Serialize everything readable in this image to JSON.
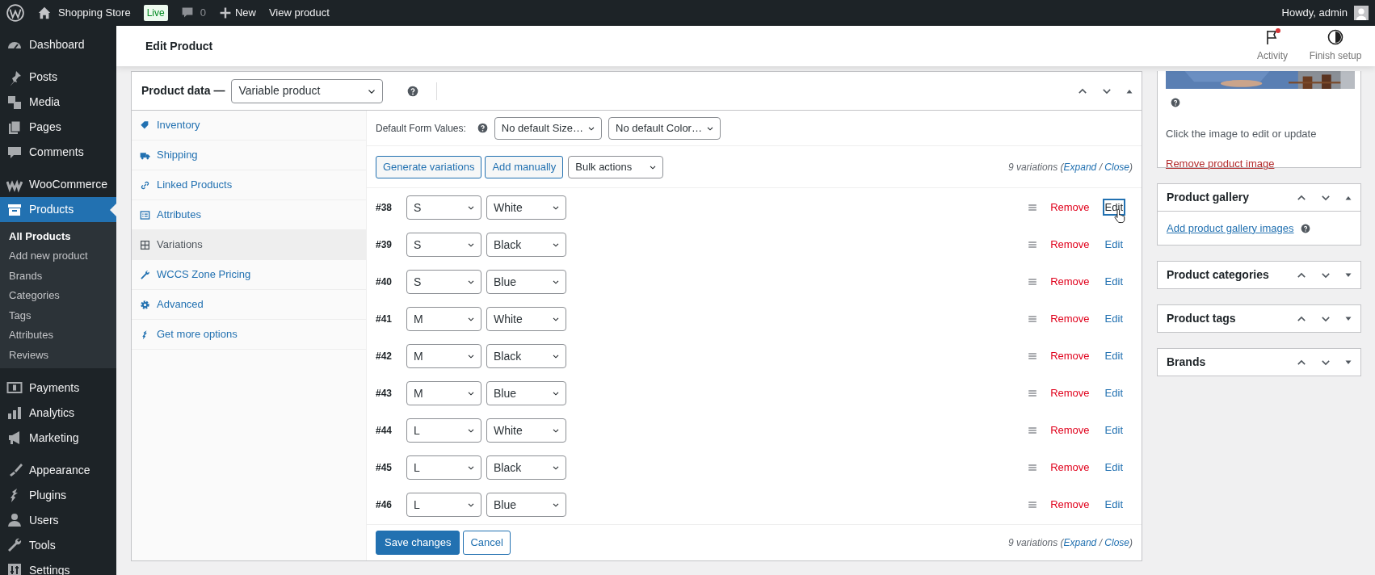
{
  "admin_bar": {
    "site_name": "Shopping Store",
    "badge": "Live",
    "comments": "0",
    "new": "New",
    "view": "View product",
    "greeting": "Howdy, admin"
  },
  "sidebar": {
    "groups": [
      [
        {
          "label": "Dashboard",
          "selected": false
        }
      ],
      [
        {
          "label": "Posts",
          "selected": false
        },
        {
          "label": "Media",
          "selected": false
        },
        {
          "label": "Pages",
          "selected": false
        },
        {
          "label": "Comments",
          "selected": false
        }
      ],
      [
        {
          "label": "WooCommerce",
          "selected": false
        },
        {
          "label": "Products",
          "selected": true,
          "children": [
            {
              "label": "All Products",
              "selected": true
            },
            {
              "label": "Add new product",
              "selected": false
            },
            {
              "label": "Brands",
              "selected": false
            },
            {
              "label": "Categories",
              "selected": false
            },
            {
              "label": "Tags",
              "selected": false
            },
            {
              "label": "Attributes",
              "selected": false
            },
            {
              "label": "Reviews",
              "selected": false
            }
          ]
        }
      ],
      [
        {
          "label": "Payments",
          "selected": false
        },
        {
          "label": "Analytics",
          "selected": false
        },
        {
          "label": "Marketing",
          "selected": false
        }
      ],
      [
        {
          "label": "Appearance",
          "selected": false
        },
        {
          "label": "Plugins",
          "selected": false
        },
        {
          "label": "Users",
          "selected": false
        },
        {
          "label": "Tools",
          "selected": false
        },
        {
          "label": "Settings",
          "selected": false
        }
      ]
    ]
  },
  "header": {
    "title": "Edit Product",
    "actions": [
      {
        "label": "Activity",
        "notification": true
      },
      {
        "label": "Finish setup",
        "notification": false
      }
    ]
  },
  "product_data": {
    "label": "Product data —",
    "type": "Variable product",
    "tabs": [
      {
        "label": "Inventory",
        "selected": false
      },
      {
        "label": "Shipping",
        "selected": false
      },
      {
        "label": "Linked Products",
        "selected": false
      },
      {
        "label": "Attributes",
        "selected": false
      },
      {
        "label": "Variations",
        "selected": true
      },
      {
        "label": "WCCS Zone Pricing",
        "selected": false
      },
      {
        "label": "Advanced",
        "selected": false
      },
      {
        "label": "Get more options",
        "selected": false
      }
    ],
    "default_form": {
      "label": "Default Form Values:",
      "selects": [
        "No default Size…",
        "No default Color…"
      ]
    },
    "actions": {
      "buttons": [
        "Generate variations",
        "Add manually"
      ],
      "bulk": "Bulk actions"
    },
    "summary_top": [
      {
        "text": "9 variations (",
        "link": false
      },
      {
        "text": "Expand",
        "link": true
      },
      {
        "text": " / ",
        "link": false
      },
      {
        "text": "Close",
        "link": true
      },
      {
        "text": ")",
        "link": false
      }
    ],
    "variations": [
      {
        "id": "#38",
        "size": "S",
        "color_name": "White",
        "remove": "Remove",
        "edit": "Edit",
        "focused": true
      },
      {
        "id": "#39",
        "size": "S",
        "color_name": "Black",
        "remove": "Remove",
        "edit": "Edit",
        "focused": false
      },
      {
        "id": "#40",
        "size": "S",
        "color_name": "Blue",
        "remove": "Remove",
        "edit": "Edit",
        "focused": false
      },
      {
        "id": "#41",
        "size": "M",
        "color_name": "White",
        "remove": "Remove",
        "edit": "Edit",
        "focused": false
      },
      {
        "id": "#42",
        "size": "M",
        "color_name": "Black",
        "remove": "Remove",
        "edit": "Edit",
        "focused": false
      },
      {
        "id": "#43",
        "size": "M",
        "color_name": "Blue",
        "remove": "Remove",
        "edit": "Edit",
        "focused": false
      },
      {
        "id": "#44",
        "size": "L",
        "color_name": "White",
        "remove": "Remove",
        "edit": "Edit",
        "focused": false
      },
      {
        "id": "#45",
        "size": "L",
        "color_name": "Black",
        "remove": "Remove",
        "edit": "Edit",
        "focused": false
      },
      {
        "id": "#46",
        "size": "L",
        "color_name": "Blue",
        "remove": "Remove",
        "edit": "Edit",
        "focused": false
      }
    ],
    "save": "Save changes",
    "cancel": "Cancel",
    "summary_bottom": [
      {
        "text": "9 variations (",
        "link": false
      },
      {
        "text": "Expand",
        "link": true
      },
      {
        "text": " / ",
        "link": false
      },
      {
        "text": "Close",
        "link": true
      },
      {
        "text": ")",
        "link": false
      }
    ]
  },
  "product_image": {
    "hint": "Click the image to edit or update",
    "remove": "Remove product image"
  },
  "side_boxes": [
    {
      "title": "Product gallery",
      "expanded": true,
      "link": "Add product gallery images"
    },
    {
      "title": "Product categories",
      "expanded": false
    },
    {
      "title": "Product tags",
      "expanded": false
    },
    {
      "title": "Brands",
      "expanded": false
    }
  ]
}
